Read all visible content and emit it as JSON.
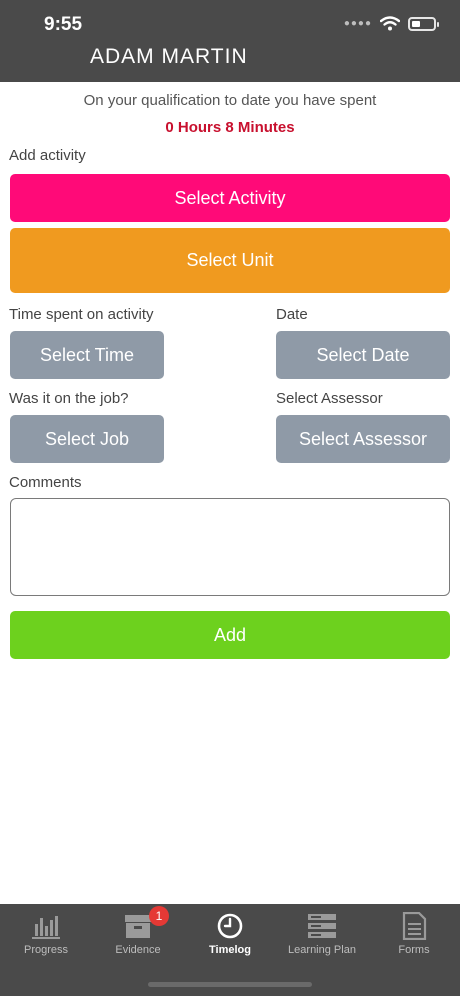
{
  "status_bar": {
    "time": "9:55"
  },
  "header": {
    "title": "ADAM MARTIN"
  },
  "summary": {
    "line": "On your qualification to date you have spent",
    "total": "0 Hours 8 Minutes"
  },
  "form": {
    "add_activity_label": "Add activity",
    "select_activity": "Select Activity",
    "select_unit": "Select Unit",
    "time_label": "Time spent on activity",
    "date_label": "Date",
    "select_time": "Select Time",
    "select_date": "Select Date",
    "job_label": "Was it on the job?",
    "assessor_label": "Select Assessor",
    "select_job": "Select Job",
    "select_assessor": "Select Assessor",
    "comments_label": "Comments",
    "comments_value": "",
    "add_label": "Add"
  },
  "tabs": [
    {
      "label": "Progress",
      "icon": "bar-chart-icon",
      "active": false
    },
    {
      "label": "Evidence",
      "icon": "archive-box-icon",
      "active": false,
      "badge": "1"
    },
    {
      "label": "Timelog",
      "icon": "clock-icon",
      "active": true
    },
    {
      "label": "Learning Plan",
      "icon": "list-stack-icon",
      "active": false
    },
    {
      "label": "Forms",
      "icon": "document-icon",
      "active": false
    }
  ],
  "colors": {
    "header_bg": "#4a4a4a",
    "activity_button": "#ff0a78",
    "unit_button": "#f09a1f",
    "grey_button": "#8f9aa7",
    "add_button": "#6dd11e",
    "total_text": "#c8102e"
  }
}
